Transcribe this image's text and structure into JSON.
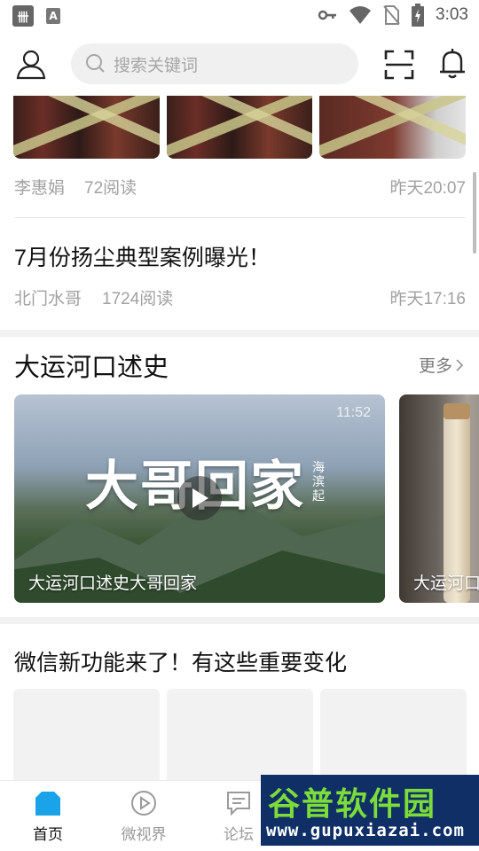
{
  "status_bar": {
    "time": "3:03",
    "icon_left_1": "卌",
    "icon_left_2": "A"
  },
  "header": {
    "search_placeholder": "搜索关键词"
  },
  "feed": {
    "item1": {
      "author": "李惠娟",
      "reads": "72阅读",
      "time": "昨天20:07"
    },
    "item2": {
      "title": "7月份扬尘典型案例曝光！",
      "author": "北门水哥",
      "reads": "1724阅读",
      "time": "昨天17:16"
    }
  },
  "video_section": {
    "title": "大运河口述史",
    "more_label": "更多",
    "videos": [
      {
        "caption": "大运河口述史大哥回家",
        "duration": "11:52",
        "art_text": "大哥回家",
        "art_small": "海滨起"
      },
      {
        "caption": "大运河口"
      }
    ]
  },
  "headline2": {
    "title": "微信新功能来了！有这些重要变化"
  },
  "bottom_nav": {
    "items": [
      {
        "label": "首页",
        "active": true
      },
      {
        "label": "微视界",
        "active": false
      },
      {
        "label": "论坛",
        "active": false
      }
    ]
  },
  "watermark": {
    "title": "谷普软件园",
    "url": "www.gupuxiazai.com"
  },
  "colors": {
    "accent": "#1aa3e8",
    "text_secondary": "#a1a1a1",
    "divider": "#e6e6e6"
  }
}
